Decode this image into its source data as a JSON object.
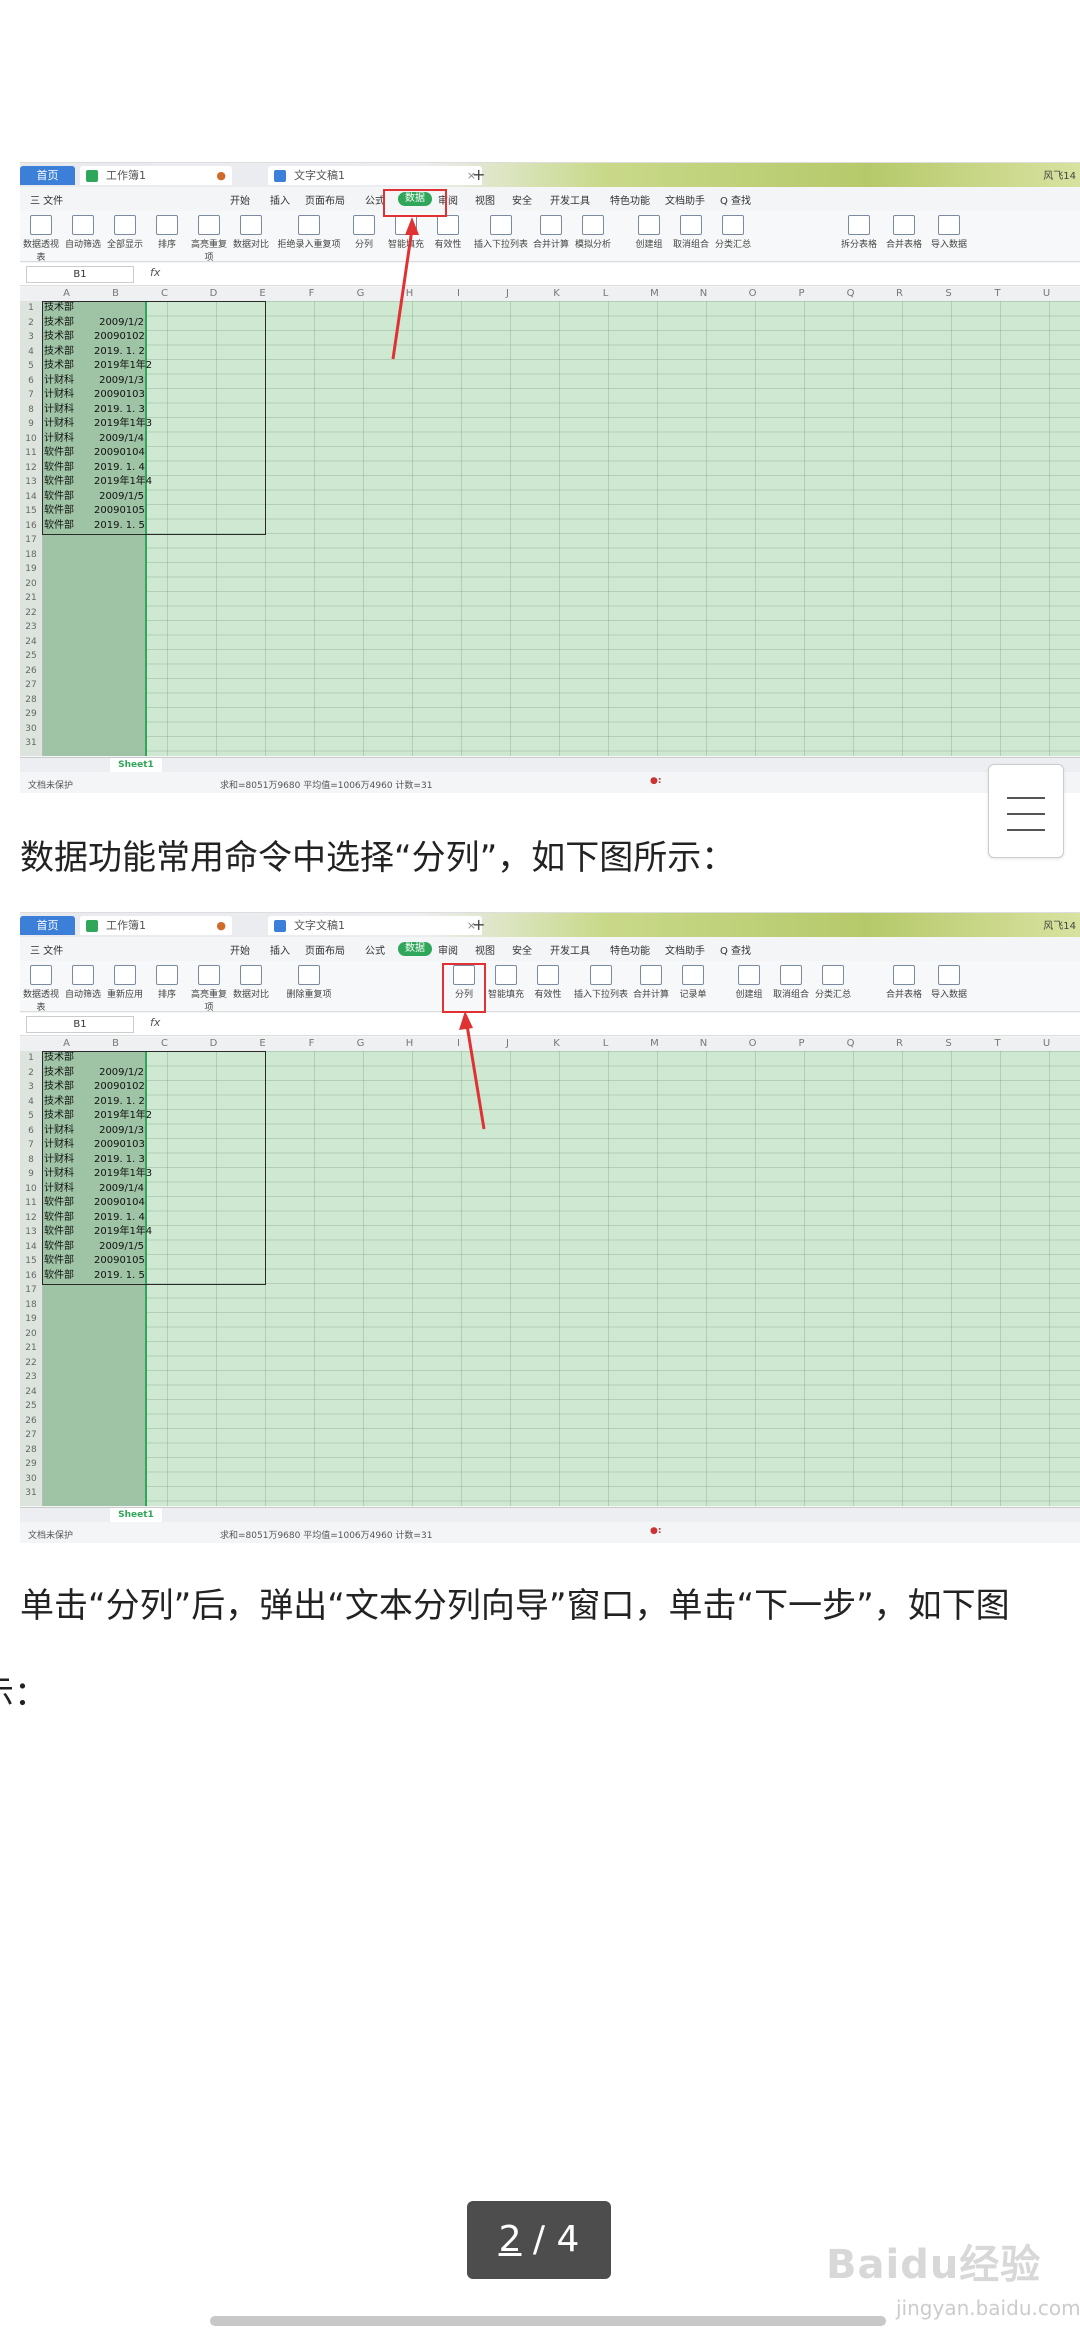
{
  "tabs": {
    "home": "首页",
    "book": "工作簿1",
    "doc": "文字文稿1",
    "user": "风飞14"
  },
  "menu": [
    "三 文件",
    "开始",
    "插入",
    "页面布局",
    "公式",
    "数据",
    "审阅",
    "视图",
    "安全",
    "开发工具",
    "特色功能",
    "文档助手",
    "Q 查找"
  ],
  "toolbar": [
    "数据透视表",
    "自动筛选",
    "全部显示",
    "重新应用",
    "排序",
    "高亮重复项",
    "数据对比",
    "删除重复项",
    "拒绝录入重复项",
    "分列",
    "智能填充",
    "有效性",
    "插入下拉列表",
    "合并计算",
    "模拟分析",
    "记录单",
    "创建组",
    "取消组合",
    "分类汇总",
    "拆分表格",
    "合并表格",
    "导入数据"
  ],
  "namebox": "B1",
  "fx": "fx",
  "columns": [
    "A",
    "B",
    "C",
    "D",
    "E",
    "F",
    "G",
    "H",
    "I",
    "J",
    "K",
    "L",
    "M",
    "N",
    "O",
    "P",
    "Q",
    "R",
    "S",
    "T",
    "U"
  ],
  "rows": [
    {
      "a": "技术部",
      "b": ""
    },
    {
      "a": "技术部",
      "b": "2009/1/2"
    },
    {
      "a": "技术部",
      "b": "20090102"
    },
    {
      "a": "技术部",
      "b": "2019. 1. 2"
    },
    {
      "a": "技术部",
      "b": "2019年1年2"
    },
    {
      "a": "计财科",
      "b": "2009/1/3"
    },
    {
      "a": "计财科",
      "b": "20090103"
    },
    {
      "a": "计财科",
      "b": "2019. 1. 3"
    },
    {
      "a": "计财科",
      "b": "2019年1年3"
    },
    {
      "a": "计财科",
      "b": "2009/1/4"
    },
    {
      "a": "软件部",
      "b": "20090104"
    },
    {
      "a": "软件部",
      "b": "2019. 1. 4"
    },
    {
      "a": "软件部",
      "b": "2019年1年4"
    },
    {
      "a": "软件部",
      "b": "2009/1/5"
    },
    {
      "a": "软件部",
      "b": "20090105"
    },
    {
      "a": "软件部",
      "b": "2019. 1. 5"
    }
  ],
  "sheet": "Sheet1",
  "status": {
    "protect": "文档未保护",
    "calc": "求和=8051万9680  平均值=1006万4960  计数=31"
  },
  "captions": {
    "c1": "数据功能常用命令中选择“分列”，如下图所示：",
    "c2": "单击“分列”后，弹出“文本分列向导”窗口，单击“下一步”，如下图",
    "c2b": "示："
  },
  "pager": {
    "current": "2",
    "sep": " / ",
    "total": "4"
  },
  "watermark": {
    "main": "Baidu经验",
    "sub": "jingyan.baidu.com"
  }
}
